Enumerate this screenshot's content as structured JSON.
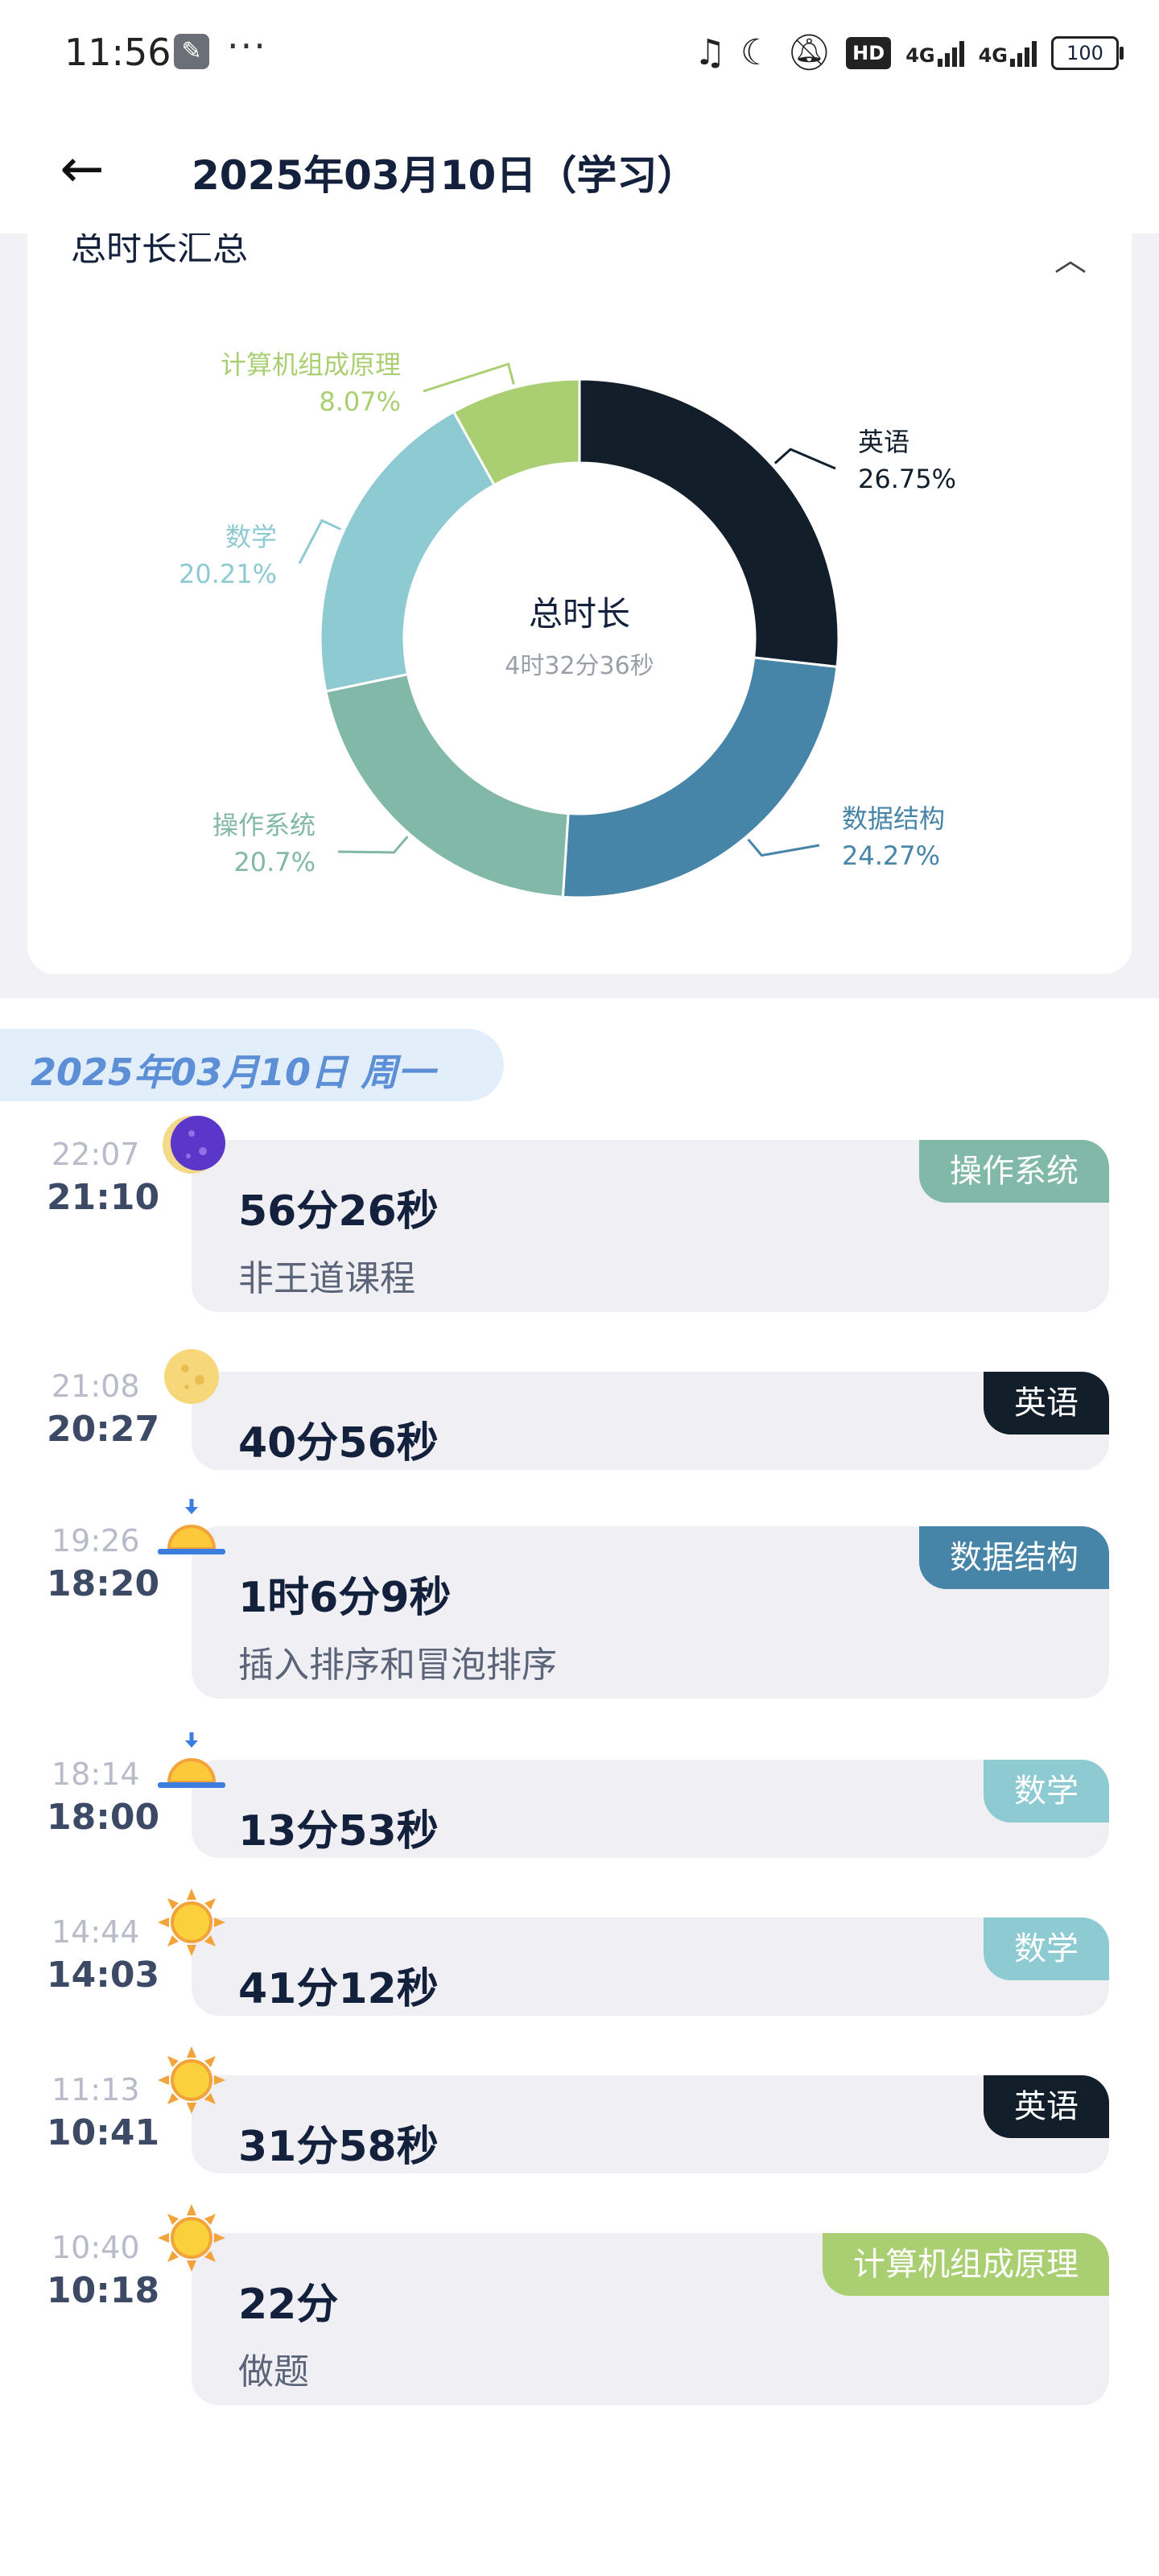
{
  "status_bar": {
    "time": "11:56",
    "network_1": "4G",
    "network_2": "4G",
    "hd": "HD",
    "battery": "100"
  },
  "header": {
    "back_icon": "arrow-left-icon",
    "title": "2025年03月10日（学习）"
  },
  "summary": {
    "title": "总时长汇总",
    "collapse_icon": "chevron-up-icon",
    "center_label": "总时长",
    "center_value": "4时32分36秒"
  },
  "chart_data": {
    "type": "pie",
    "donut": true,
    "categories": [
      "英语",
      "数据结构",
      "操作系统",
      "数学",
      "计算机组成原理"
    ],
    "values": [
      26.75,
      24.27,
      20.7,
      20.21,
      8.07
    ],
    "labels": [
      "26.75%",
      "24.27%",
      "20.7%",
      "20.21%",
      "8.07%"
    ],
    "colors": [
      "#121f2b",
      "#4684a8",
      "#82b8a7",
      "#8ecad2",
      "#a9cf72"
    ]
  },
  "day_header": "2025年03月10日  周一",
  "records": [
    {
      "end": "22:07",
      "start": "21:10",
      "duration": "56分26秒",
      "note": "非王道课程",
      "tag": "操作系统",
      "tag_color": "#82b8a7",
      "icon": "moon-icon"
    },
    {
      "end": "21:08",
      "start": "20:27",
      "duration": "40分56秒",
      "note": "",
      "tag": "英语",
      "tag_color": "#121f2b",
      "icon": "full-moon-icon"
    },
    {
      "end": "19:26",
      "start": "18:20",
      "duration": "1时6分9秒",
      "note": "插入排序和冒泡排序",
      "tag": "数据结构",
      "tag_color": "#4684a8",
      "icon": "sunset-icon"
    },
    {
      "end": "18:14",
      "start": "18:00",
      "duration": "13分53秒",
      "note": "",
      "tag": "数学",
      "tag_color": "#8ecad2",
      "icon": "sunset-icon"
    },
    {
      "end": "14:44",
      "start": "14:03",
      "duration": "41分12秒",
      "note": "",
      "tag": "数学",
      "tag_color": "#8ecad2",
      "icon": "sun-icon"
    },
    {
      "end": "11:13",
      "start": "10:41",
      "duration": "31分58秒",
      "note": "",
      "tag": "英语",
      "tag_color": "#121f2b",
      "icon": "sun-icon"
    },
    {
      "end": "10:40",
      "start": "10:18",
      "duration": "22分",
      "note": "做题",
      "tag": "计算机组成原理",
      "tag_color": "#a9cf72",
      "icon": "sun-icon"
    }
  ]
}
